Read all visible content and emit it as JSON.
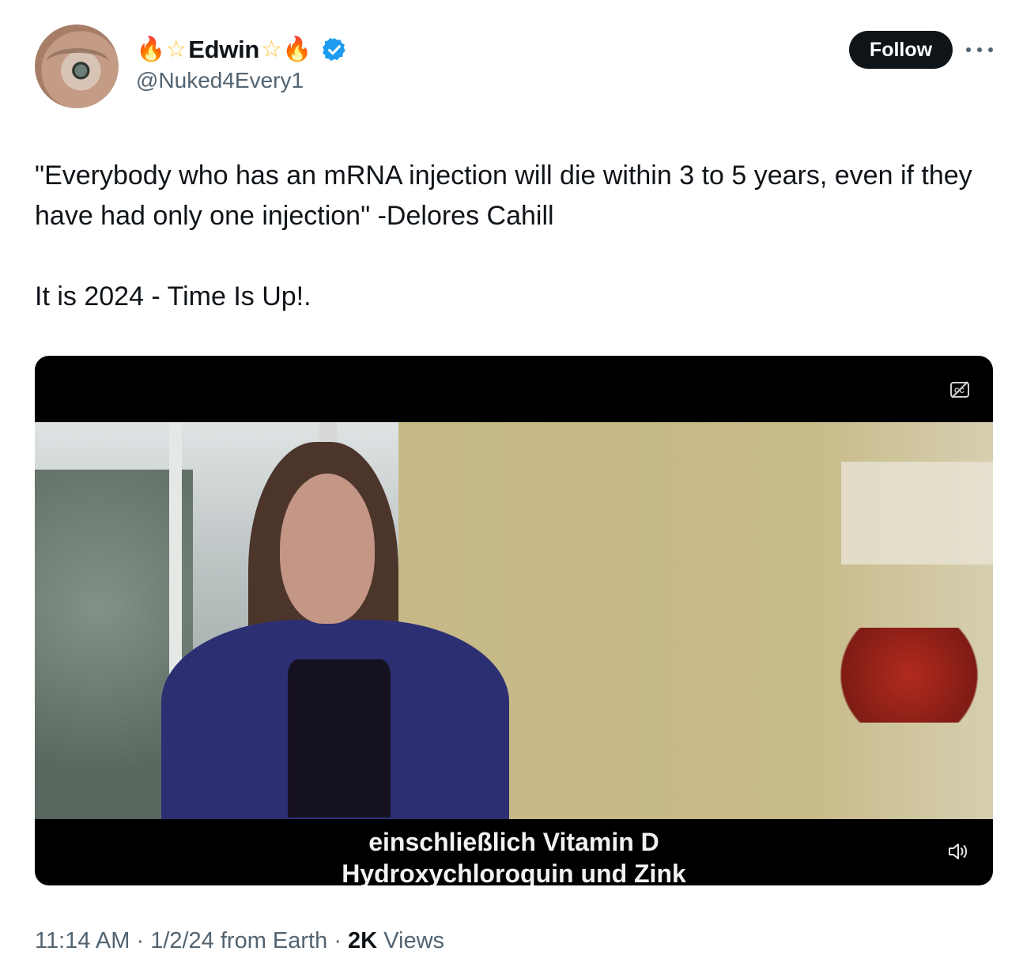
{
  "author": {
    "display_name": "Edwin",
    "handle": "@Nuked4Every1",
    "name_decorations": [
      "fire-emoji",
      "star-emoji",
      "star-emoji",
      "fire-emoji"
    ],
    "verified": true,
    "verified_color": "#1d9bf0"
  },
  "actions": {
    "follow_label": "Follow"
  },
  "tweet": {
    "paragraph_1": "\"Everybody who has an mRNA injection will die within 3 to 5 years, even if they have had only one injection\" -Delores Cahill",
    "paragraph_2": "It is 2024 - Time Is Up!."
  },
  "video": {
    "subtitle_line_1": "einschließlich Vitamin D",
    "subtitle_line_2": "Hydroxychloroquin und Zink",
    "captions_icon": "closed-captions-icon",
    "volume_icon": "volume-icon"
  },
  "meta": {
    "time": "11:14 AM",
    "separator_1": "·",
    "date_source": "1/2/24 from Earth",
    "separator_2": "·",
    "views_count": "2K",
    "views_label": "Views"
  },
  "colors": {
    "text_primary": "#0f1419",
    "text_secondary": "#536471",
    "button_bg": "#0f1419"
  }
}
